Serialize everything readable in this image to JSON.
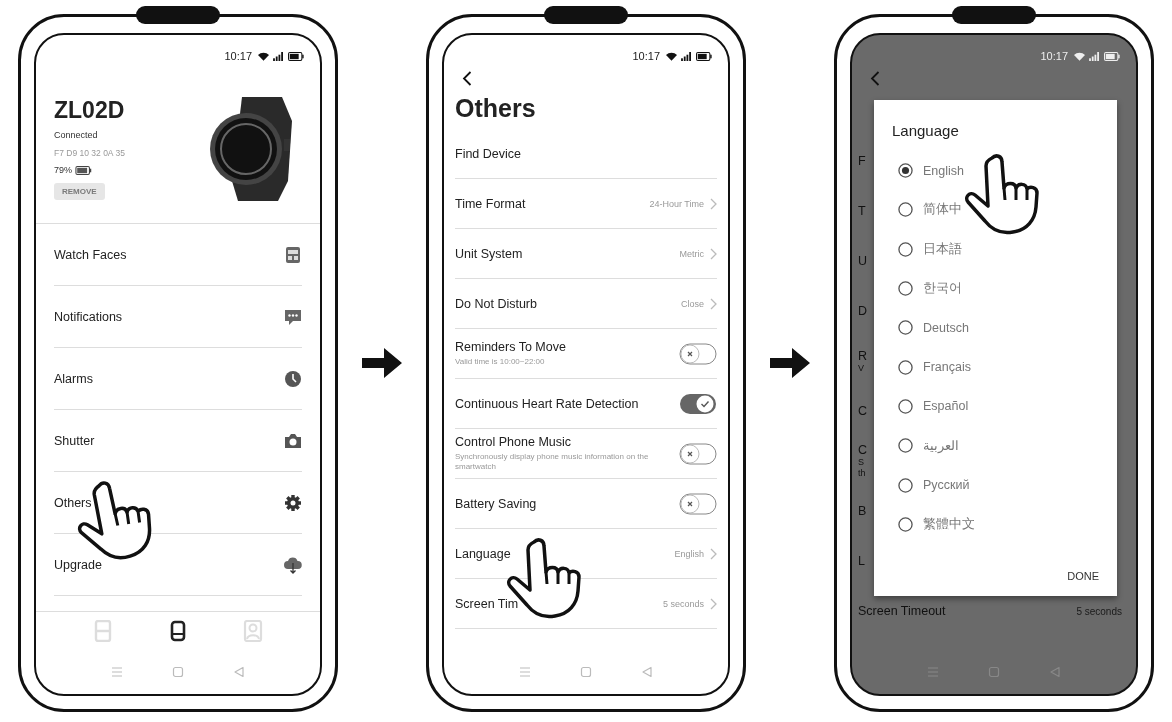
{
  "home_screen": {
    "status_time": "10:17",
    "device": {
      "name": "ZL02D",
      "status": "Connected",
      "address": "F7 D9 10 32 0A 35",
      "battery": "79%",
      "remove_button": {
        "label": "REMOVE",
        "disabled": true
      }
    },
    "menu": [
      {
        "label": "Watch Faces"
      },
      {
        "label": "Notifications"
      },
      {
        "label": "Alarms"
      },
      {
        "label": "Shutter"
      },
      {
        "label": "Others"
      },
      {
        "label": "Upgrade"
      }
    ],
    "tabs": [
      {
        "selected": false
      },
      {
        "selected": true
      },
      {
        "selected": false
      }
    ]
  },
  "others_screen": {
    "status_time": "10:17",
    "title": "Others",
    "rows": [
      {
        "kind": "plain",
        "label": "Find Device"
      },
      {
        "kind": "value",
        "label": "Time Format",
        "value": "24-Hour Time"
      },
      {
        "kind": "value",
        "label": "Unit System",
        "value": "Metric"
      },
      {
        "kind": "value",
        "label": "Do Not Disturb",
        "value": "Close"
      },
      {
        "kind": "toggle",
        "label": "Reminders To Move",
        "sublabel": "Valid time is 10:00~22:00",
        "on": false
      },
      {
        "kind": "toggle",
        "label": "Continuous Heart Rate Detection",
        "on": true
      },
      {
        "kind": "toggle",
        "label": "Control Phone Music",
        "sublabel": "Synchronously display phone music information on the smartwatch",
        "on": false
      },
      {
        "kind": "toggle",
        "label": "Battery Saving",
        "on": false
      },
      {
        "kind": "value",
        "label": "Language",
        "value": "English"
      },
      {
        "kind": "value",
        "label": "Screen Tim",
        "value": "5 seconds"
      }
    ]
  },
  "language_screen": {
    "status_time": "10:17",
    "background_rows": [
      {
        "label": "F"
      },
      {
        "label": "T"
      },
      {
        "label": "U"
      },
      {
        "label": "D"
      },
      {
        "label": "R",
        "sublabels": [
          "V"
        ]
      },
      {
        "label": "C"
      },
      {
        "label": "C",
        "sublabels": [
          "S",
          "th"
        ]
      },
      {
        "label": "B"
      },
      {
        "label": "L"
      },
      {
        "label": "Screen Timeout",
        "value": "5 seconds"
      }
    ],
    "dialog": {
      "title": "Language",
      "options": [
        {
          "label": "English",
          "selected": true
        },
        {
          "label": "简体中",
          "selected": false
        },
        {
          "label": "日本語",
          "selected": false
        },
        {
          "label": "한국어",
          "selected": false
        },
        {
          "label": "Deutsch",
          "selected": false
        },
        {
          "label": "Français",
          "selected": false
        },
        {
          "label": "Español",
          "selected": false
        },
        {
          "label": "العربية",
          "selected": false
        },
        {
          "label": "Русский",
          "selected": false
        },
        {
          "label": "繁體中文",
          "selected": false
        }
      ],
      "done_button": "DONE"
    }
  }
}
